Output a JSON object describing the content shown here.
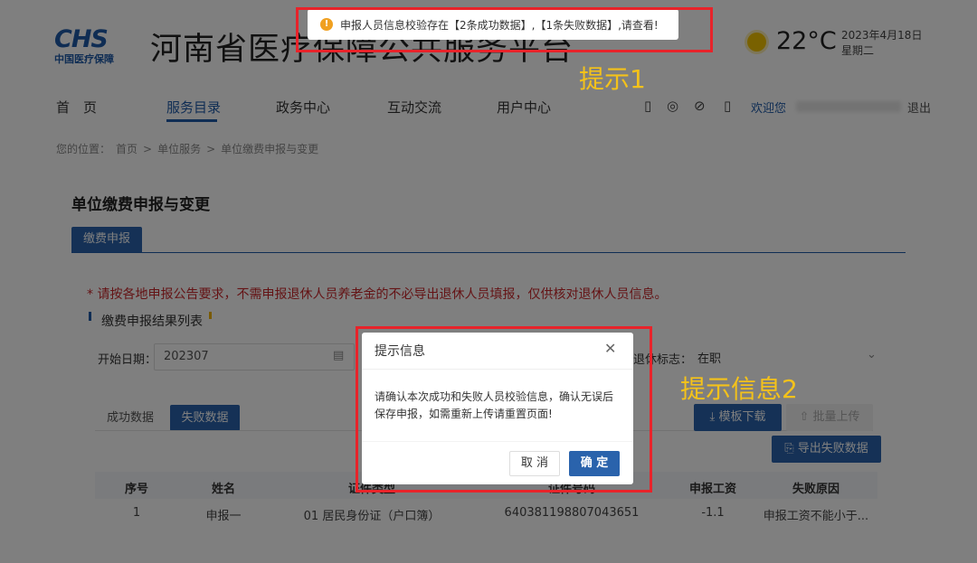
{
  "header": {
    "logo_mark": "CHS",
    "logo_sub": "中国医疗保障",
    "site_title": "河南省医疗保障公共服务平台",
    "temperature": "22°C",
    "date": "2023年4月18日",
    "weekday": "星期二"
  },
  "nav": {
    "items": [
      {
        "label": "首　页"
      },
      {
        "label": "服务目录"
      },
      {
        "label": "政务中心"
      },
      {
        "label": "互动交流"
      },
      {
        "label": "用户中心"
      }
    ],
    "welcome": "欢迎您",
    "logout": "退出"
  },
  "breadcrumb": {
    "prefix": "您的位置：",
    "items": [
      "首页",
      "单位服务",
      "单位缴费申报与变更"
    ],
    "separator": ">"
  },
  "page": {
    "title": "单位缴费申报与变更",
    "tab": "缴费申报",
    "notice": "* 请按各地申报公告要求，不需申报退休人员养老金的不必导出退休人员填报，仅供核对退休人员信息。",
    "section_title": "缴费申报结果列表"
  },
  "filters": {
    "start_date_label": "开始日期：",
    "start_date_value": "202307",
    "status_label": "退休标志：",
    "status_value": "在职"
  },
  "result_tabs": {
    "success": "成功数据",
    "failure": "失败数据"
  },
  "buttons": {
    "template_download": "模板下载",
    "batch_upload": "批量上传",
    "export_failures": "导出失败数据"
  },
  "table": {
    "headers": [
      "序号",
      "姓名",
      "证件类型",
      "证件号码",
      "申报工资",
      "失败原因"
    ],
    "rows": [
      [
        "1",
        "申报一",
        "01 居民身份证（户口簿）",
        "640381198807043651",
        "-1.1",
        "申报工资不能小于..."
      ]
    ]
  },
  "toast": {
    "message": "申报人员信息校验存在【2条成功数据】,【1条失败数据】,请查看!"
  },
  "dialog": {
    "title": "提示信息",
    "body": "请确认本次成功和失败人员校验信息，确认无误后保存申报，如需重新上传请重置页面!",
    "cancel": "取 消",
    "ok": "确 定"
  },
  "annotations": {
    "label1": "提示1",
    "label2": "提示信息2"
  },
  "colors": {
    "brand": "#2a63ac",
    "annotation_box": "#e8232a",
    "annotation_text": "#f4c21a",
    "notice": "#c9262a",
    "warning": "#f0a020"
  },
  "icons": [
    "sun-icon",
    "mobile-icon",
    "wechat-icon",
    "accessibility-icon",
    "phone-icon",
    "calendar-icon",
    "chevron-down-icon",
    "download-icon",
    "upload-icon",
    "export-icon",
    "warning-icon",
    "close-icon"
  ]
}
